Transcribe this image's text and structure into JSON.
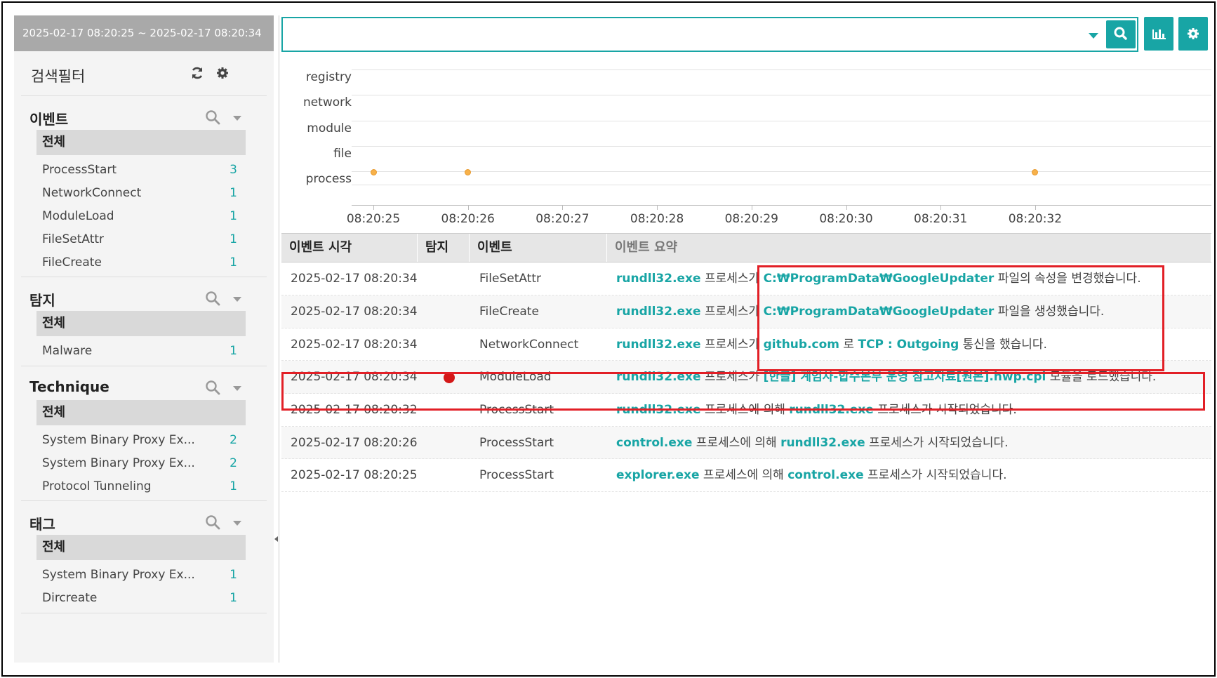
{
  "range": "2025-02-17 08:20:25 ~ 2025-02-17 08:20:34",
  "filter": {
    "title": "검색필터",
    "icons": [
      "refresh-icon",
      "gear-icon"
    ]
  },
  "sections": [
    {
      "title": "이벤트",
      "all": "전체",
      "items": [
        {
          "label": "ProcessStart",
          "count": "3"
        },
        {
          "label": "NetworkConnect",
          "count": "1"
        },
        {
          "label": "ModuleLoad",
          "count": "1"
        },
        {
          "label": "FileSetAttr",
          "count": "1"
        },
        {
          "label": "FileCreate",
          "count": "1"
        }
      ]
    },
    {
      "title": "탐지",
      "all": "전체",
      "items": [
        {
          "label": "Malware",
          "count": "1"
        }
      ]
    },
    {
      "title": "Technique",
      "all": "전체",
      "items": [
        {
          "label": "System Binary Proxy Ex...",
          "count": "2"
        },
        {
          "label": "System Binary Proxy Ex...",
          "count": "2"
        },
        {
          "label": "Protocol Tunneling",
          "count": "1"
        }
      ]
    },
    {
      "title": "태그",
      "all": "전체",
      "items": [
        {
          "label": "System Binary Proxy Ex...",
          "count": "1"
        },
        {
          "label": "Dircreate",
          "count": "1"
        }
      ]
    }
  ],
  "search": {
    "value": "",
    "placeholder": ""
  },
  "timeline": {
    "rows": [
      "registry",
      "network",
      "module",
      "file",
      "process"
    ],
    "ticks": [
      "08:20:25",
      "08:20:26",
      "08:20:27",
      "08:20:28",
      "08:20:29",
      "08:20:30",
      "08:20:31",
      "08:20:32"
    ],
    "events": [
      {
        "row": "process",
        "time": "08:20:25"
      },
      {
        "row": "process",
        "time": "08:20:26"
      },
      {
        "row": "process",
        "time": "08:20:32"
      }
    ]
  },
  "table": {
    "headers": [
      "이벤트 시각",
      "탐지",
      "이벤트",
      "이벤트 요약"
    ],
    "rows": [
      {
        "time": "2025-02-17 08:20:34",
        "detected": false,
        "event": "FileSetAttr",
        "summary": [
          [
            "rundll32.exe",
            true
          ],
          [
            " 프로세스가 ",
            false
          ],
          [
            "C:₩ProgramData₩GoogleUpdater",
            true
          ],
          [
            " 파일의 속성을 변경했습니다.",
            false
          ]
        ]
      },
      {
        "time": "2025-02-17 08:20:34",
        "detected": false,
        "event": "FileCreate",
        "summary": [
          [
            "rundll32.exe",
            true
          ],
          [
            " 프로세스가 ",
            false
          ],
          [
            "C:₩ProgramData₩GoogleUpdater",
            true
          ],
          [
            " 파일을 생성했습니다.",
            false
          ]
        ]
      },
      {
        "time": "2025-02-17 08:20:34",
        "detected": false,
        "event": "NetworkConnect",
        "summary": [
          [
            "rundll32.exe",
            true
          ],
          [
            " 프로세스가 ",
            false
          ],
          [
            "github.com",
            true
          ],
          [
            " 로 ",
            false
          ],
          [
            "TCP : Outgoing",
            true
          ],
          [
            " 통신을 했습니다.",
            false
          ]
        ]
      },
      {
        "time": "2025-02-17 08:20:34",
        "detected": true,
        "event": "ModuleLoad",
        "summary": [
          [
            "rundll32.exe",
            true
          ],
          [
            " 프로세스가 ",
            false
          ],
          [
            "[한글] 계엄사-합수본부 운영 참고자료[원본].hwp.cpl",
            true
          ],
          [
            " 모듈을 로드했습니다.",
            false
          ]
        ]
      },
      {
        "time": "2025-02-17 08:20:32",
        "detected": false,
        "event": "ProcessStart",
        "summary": [
          [
            "rundll32.exe",
            true
          ],
          [
            " 프로세스에 의해 ",
            false
          ],
          [
            "rundll32.exe",
            true
          ],
          [
            " 프로세스가 시작되었습니다.",
            false
          ]
        ]
      },
      {
        "time": "2025-02-17 08:20:26",
        "detected": false,
        "event": "ProcessStart",
        "summary": [
          [
            "control.exe",
            true
          ],
          [
            " 프로세스에 의해 ",
            false
          ],
          [
            "rundll32.exe",
            true
          ],
          [
            " 프로세스가 시작되었습니다.",
            false
          ]
        ]
      },
      {
        "time": "2025-02-17 08:20:25",
        "detected": false,
        "event": "ProcessStart",
        "summary": [
          [
            "explorer.exe",
            true
          ],
          [
            " 프로세스에 의해 ",
            false
          ],
          [
            "control.exe",
            true
          ],
          [
            " 프로세스가 시작되었습니다.",
            false
          ]
        ]
      }
    ]
  },
  "colors": {
    "accent": "#18a5a5",
    "detect": "#d41818",
    "annotation": "#e21f26",
    "event_dot": "#f7b14a"
  }
}
